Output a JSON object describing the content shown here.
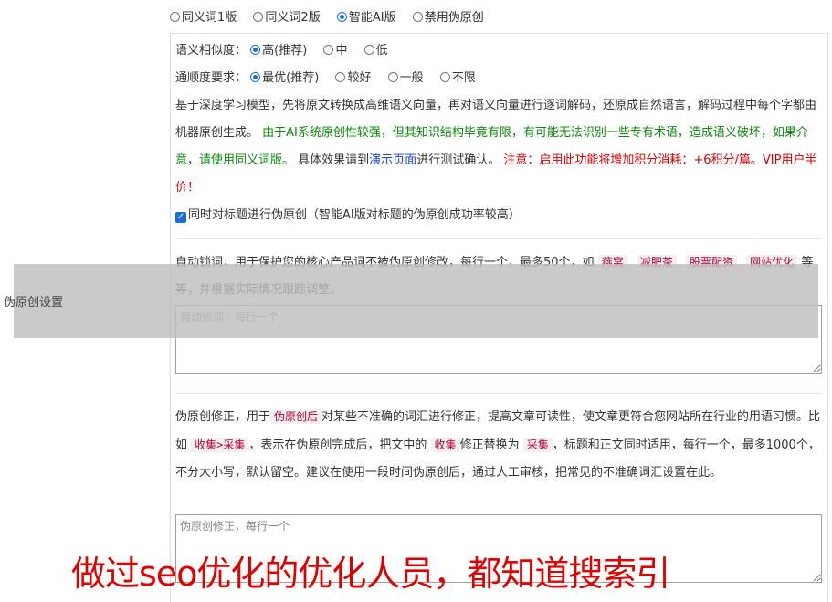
{
  "versions": {
    "options": [
      "同义词1版",
      "同义词2版",
      "智能AI版",
      "禁用伪原创"
    ],
    "selected_index": 2
  },
  "similarity": {
    "label": "语义相似度：",
    "options": [
      "高(推荐)",
      "中",
      "低"
    ],
    "selected_index": 0
  },
  "fluency": {
    "label": "通顺度要求：",
    "options": [
      "最优(推荐)",
      "较好",
      "一般",
      "不限"
    ],
    "selected_index": 0
  },
  "description": {
    "intro": "基于深度学习模型，先将原文转换成高维语义向量，再对语义向量进行逐词解码，还原成自然语言，解码过程中每个字都由机器原创生成。",
    "green_note": "由于AI系统原创性较强，但其知识结构毕竟有限，有可能无法识别一些专有术语，造成语义破坏，如果介意，请使用同义词版。",
    "effect_prefix": "具体效果请到",
    "demo_link": "演示页面",
    "effect_suffix": "进行测试确认。",
    "red_note": "注意：启用此功能将增加积分消耗：+6积分/篇。VIP用户半价！"
  },
  "title_option": {
    "checked": true,
    "label": "同时对标题进行伪原创（智能AI版对标题的伪原创成功率较高）"
  },
  "lock_words": {
    "desc_before": "自动锁词，用于保护您的核心产品词不被伪原创修改，每行一个，最多50个，如",
    "examples": [
      "燕窝",
      "减肥茶",
      "股票配资",
      "网站优化"
    ],
    "desc_after": "等等，并根据实际情况跟踪调整。",
    "placeholder": "自动锁词，每行一个"
  },
  "correction": {
    "p1": "伪原创修正，用于",
    "tag1": "伪原创后",
    "p2": "对某些不准确的词汇进行修正，提高文章可读性，使文章更符合您网站所在行业的用语习惯。比如",
    "tag2": "收集>采集",
    "p3": "，表示在伪原创完成后，把文中的",
    "tag3": "收集",
    "p4": "修正替换为",
    "tag4": "采集",
    "p5": "，标题和正文同时适用，每行一个，最多1000个，不分大小写，默认留空。建议在使用一段时间伪原创后，通过人工审核，把常见的不准确词汇设置在此。",
    "placeholder": "伪原创修正，每行一个"
  },
  "section_label": "伪原创设置",
  "watermark": "做过seo优化的优化人员，都知道搜索引",
  "colors": {
    "accent": "#1a6fd6",
    "green": "#0a8a0a",
    "red": "#d40000",
    "tag": "#b0003a"
  }
}
